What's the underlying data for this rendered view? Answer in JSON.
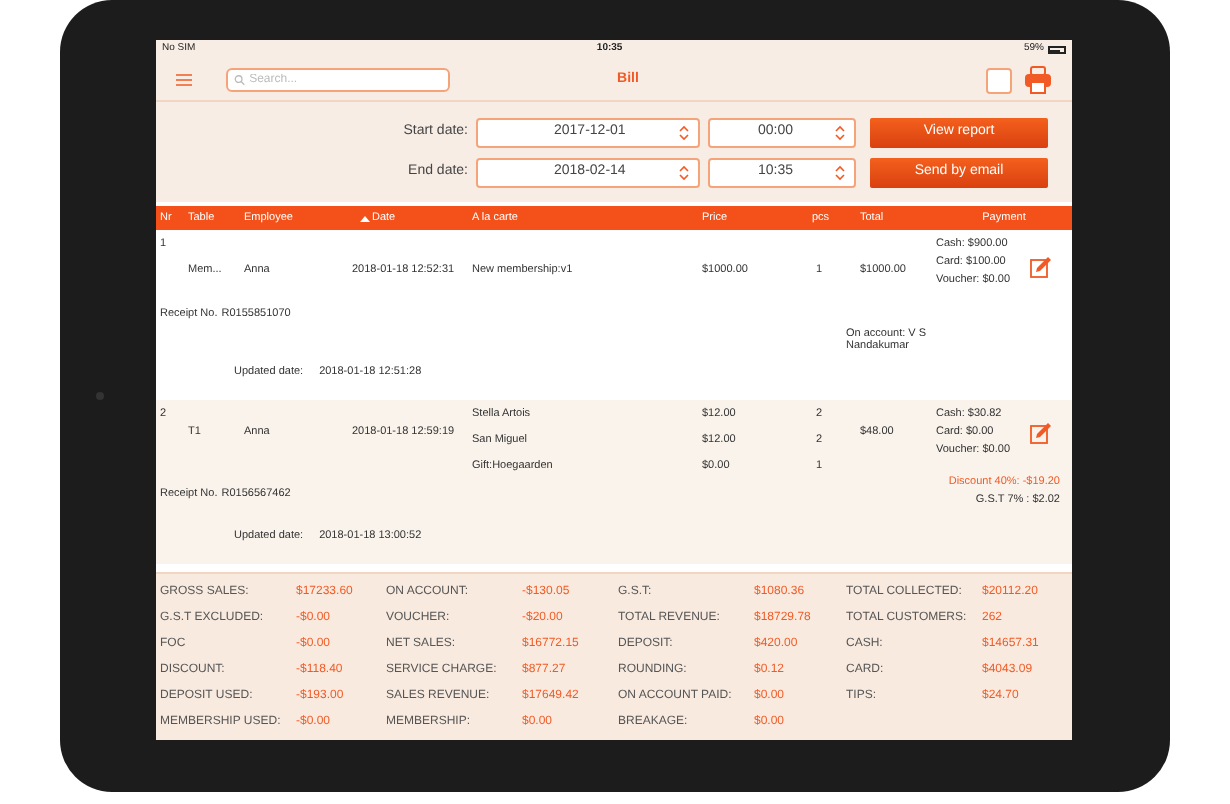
{
  "status_bar": {
    "carrier": "No SIM",
    "time": "10:35",
    "battery": "59%"
  },
  "toolbar": {
    "search": {
      "placeholder": "Search..."
    },
    "title": "Bill",
    "checked": false
  },
  "filters": [
    {
      "label": "Start date:",
      "date": "2017-12-01",
      "time": "00:00",
      "button": "View report"
    },
    {
      "label": "End date:",
      "date": "2018-02-14",
      "time": "10:35",
      "button": "Send by email"
    }
  ],
  "table": {
    "columns": [
      {
        "label": "Nr",
        "sorted": false
      },
      {
        "label": "Table",
        "sorted": false
      },
      {
        "label": "Employee",
        "sorted": false
      },
      {
        "label": "Date",
        "sorted": true
      },
      {
        "label": "A la carte",
        "sorted": false
      },
      {
        "label": "Price",
        "sorted": false
      },
      {
        "label": "pcs",
        "sorted": false
      },
      {
        "label": "Total",
        "sorted": false
      },
      {
        "label": "Payment",
        "sorted": false
      }
    ],
    "rows": [
      {
        "nr": "1",
        "table": "Mem...",
        "employee": "Anna",
        "date": "2018-01-18 12:52:31",
        "items": [
          {
            "name": "New membership:v1",
            "price": "$1000.00",
            "pcs": "1"
          }
        ],
        "total": "$1000.00",
        "payments": [
          "Cash: $900.00",
          "Card: $100.00",
          "Voucher: $0.00"
        ],
        "notes": [],
        "receipt_label": "Receipt No.",
        "receipt": "R0155851070",
        "account": "On account: V S Nandakumar",
        "updated_label": "Updated date:",
        "updated_date": "2018-01-18 12:51:28"
      },
      {
        "nr": "2",
        "table": "T1",
        "employee": "Anna",
        "date": "2018-01-18 12:59:19",
        "items": [
          {
            "name": "Stella Artois",
            "price": "$12.00",
            "pcs": "2"
          },
          {
            "name": "San Miguel",
            "price": "$12.00",
            "pcs": "2"
          },
          {
            "name": "Gift:Hoegaarden",
            "price": "$0.00",
            "pcs": "1"
          }
        ],
        "total": "$48.00",
        "payments": [
          "Cash: $30.82",
          "Card: $0.00",
          "Voucher: $0.00"
        ],
        "notes": [
          {
            "kind": "discount",
            "text": "Discount 40%: -$19.20"
          },
          {
            "kind": "tax",
            "text": "G.S.T 7% : $2.02"
          }
        ],
        "receipt_label": "Receipt No.",
        "receipt": "R0156567462",
        "updated_label": "Updated date:",
        "updated_date": "2018-01-18 13:00:52"
      }
    ]
  },
  "summary": [
    [
      {
        "label": "GROSS SALES:",
        "value": "$17233.60"
      },
      {
        "label": "ON ACCOUNT:",
        "value": "-$130.05"
      },
      {
        "label": "G.S.T:",
        "value": "$1080.36"
      },
      {
        "label": "TOTAL COLLECTED:",
        "value": "$20112.20"
      }
    ],
    [
      {
        "label": "G.S.T EXCLUDED:",
        "value": "-$0.00"
      },
      {
        "label": "VOUCHER:",
        "value": "-$20.00"
      },
      {
        "label": "TOTAL REVENUE:",
        "value": "$18729.78"
      },
      {
        "label": "TOTAL CUSTOMERS:",
        "value": "262"
      }
    ],
    [
      {
        "label": "FOC",
        "value": "-$0.00"
      },
      {
        "label": "NET SALES:",
        "value": "$16772.15"
      },
      {
        "label": "DEPOSIT:",
        "value": "$420.00"
      },
      {
        "label": "CASH:",
        "value": "$14657.31"
      }
    ],
    [
      {
        "label": "DISCOUNT:",
        "value": "-$118.40"
      },
      {
        "label": "SERVICE CHARGE:",
        "value": "$877.27"
      },
      {
        "label": "ROUNDING:",
        "value": "$0.12"
      },
      {
        "label": "CARD:",
        "value": "$4043.09"
      }
    ],
    [
      {
        "label": "DEPOSIT USED:",
        "value": "-$193.00"
      },
      {
        "label": "SALES REVENUE:",
        "value": "$17649.42"
      },
      {
        "label": "ON ACCOUNT PAID:",
        "value": "$0.00"
      },
      {
        "label": "TIPS:",
        "value": "$24.70"
      }
    ],
    [
      {
        "label": "MEMBERSHIP USED:",
        "value": "-$0.00"
      },
      {
        "label": "MEMBERSHIP:",
        "value": "$0.00"
      },
      {
        "label": "BREAKAGE:",
        "value": "$0.00"
      }
    ]
  ]
}
